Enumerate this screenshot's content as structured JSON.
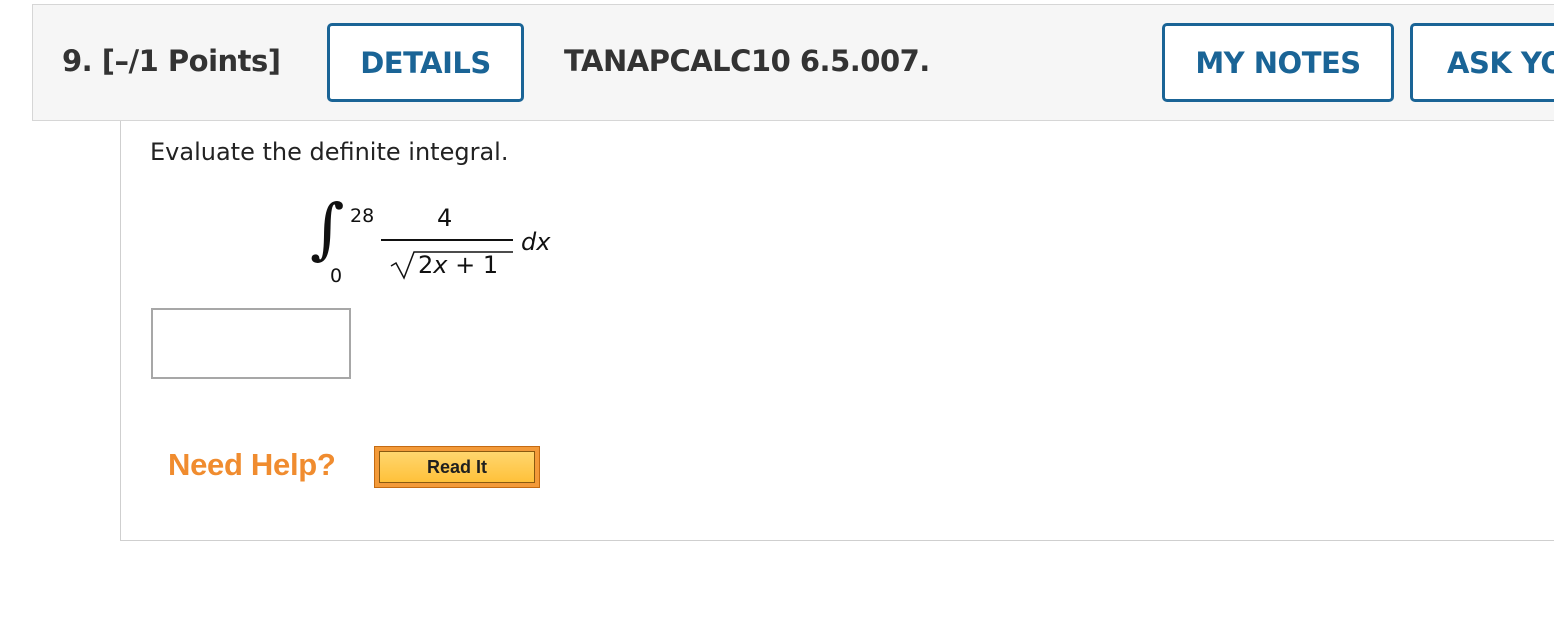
{
  "header": {
    "question_label": "9.  [–/1 Points]",
    "details_label": "DETAILS",
    "problem_id": "TANAPCALC10 6.5.007.",
    "my_notes_label": "MY NOTES",
    "ask_label": "ASK YO"
  },
  "question": {
    "prompt": "Evaluate the definite integral.",
    "integral": {
      "upper_limit": "28",
      "lower_limit": "0",
      "numerator": "4",
      "radicand_a": "2",
      "radicand_var": "x",
      "radicand_b": " + 1",
      "differential": "dx"
    },
    "answer_value": ""
  },
  "help": {
    "label": "Need Help?",
    "read_it_label": "Read It"
  },
  "colors": {
    "accent_blue": "#1a6496",
    "help_orange": "#f08c2f",
    "button_orange": "#f39a39"
  }
}
